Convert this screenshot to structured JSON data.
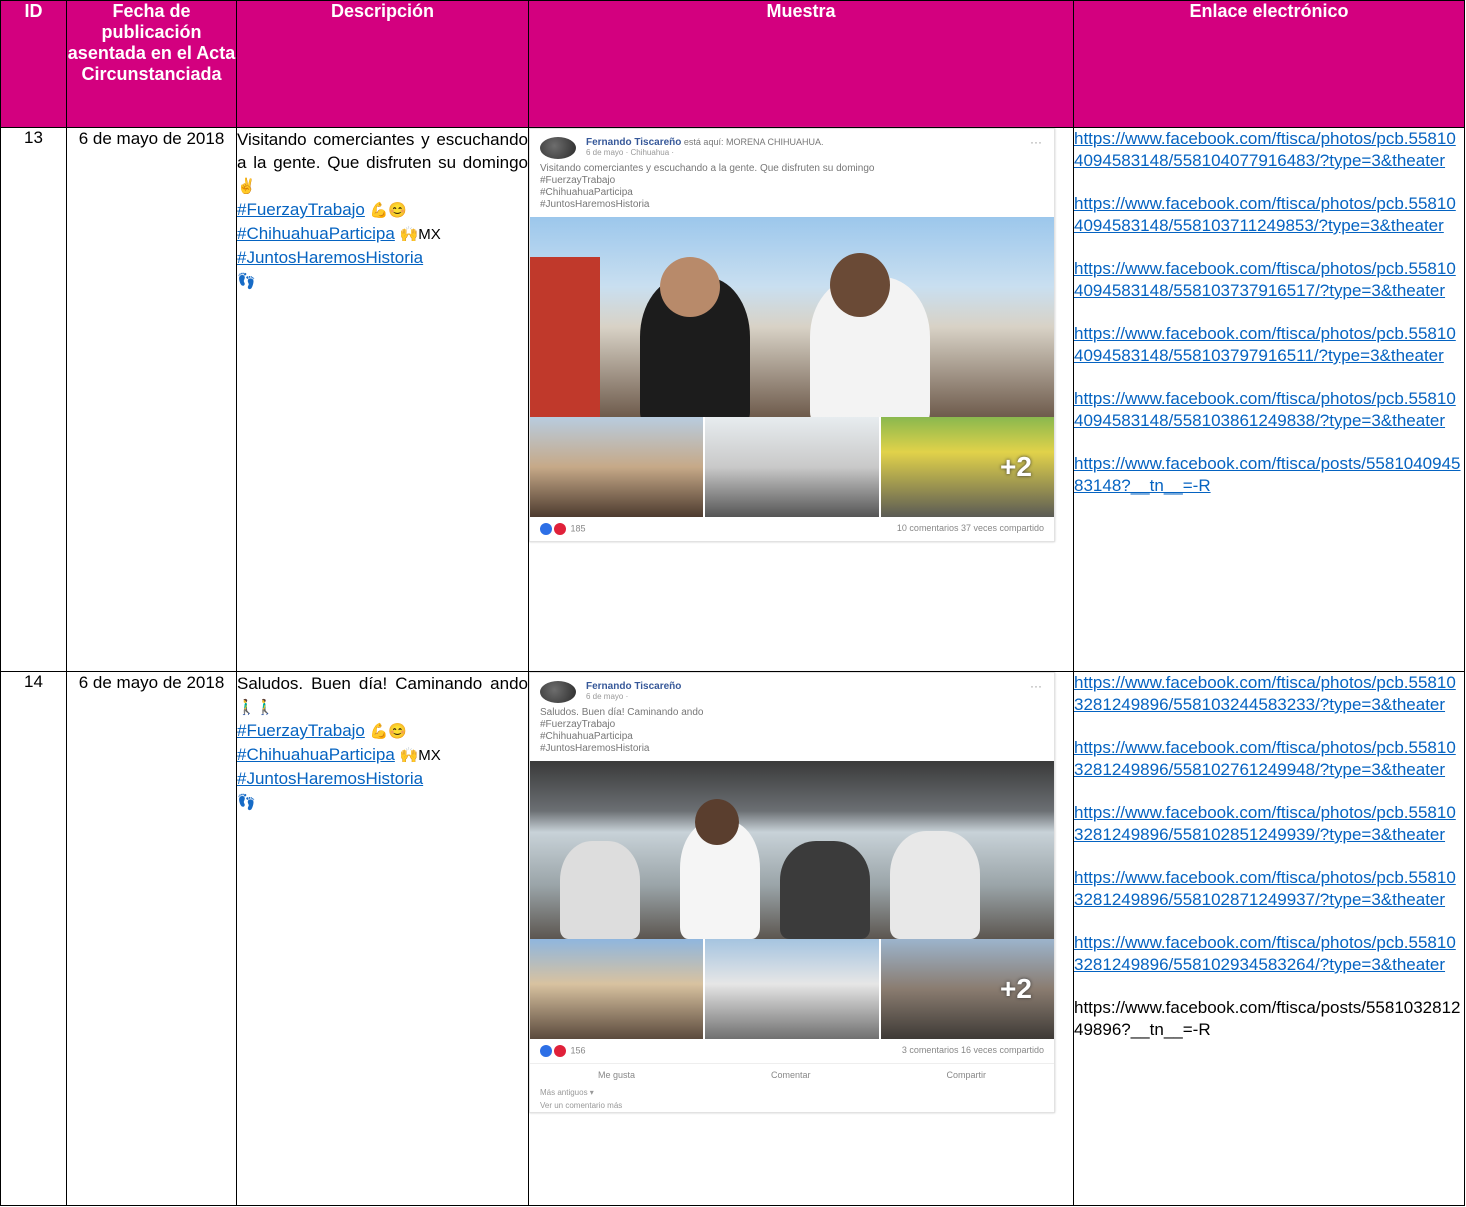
{
  "headers": {
    "id": "ID",
    "fecha": "Fecha de publicación asentada en el Acta Circunstanciada",
    "descripcion": "Descripción",
    "muestra": "Muestra",
    "enlace": "Enlace electrónico"
  },
  "rows": [
    {
      "id": "13",
      "fecha": "6 de mayo de 2018",
      "desc_text": "Visitando comerciantes y escuchando a la gente. Que disfruten su domingo",
      "desc_emoji": "✌",
      "tags": [
        {
          "tag": "#FuerzayTrabajo",
          "emoji": "💪😊"
        },
        {
          "tag": "#ChihuahuaParticipa",
          "emoji": "🙌MX"
        },
        {
          "tag": "#JuntosHaremosHistoria",
          "emoji": ""
        }
      ],
      "tail_emoji": "👣",
      "post": {
        "author": "Fernando Tiscareño",
        "author_suffix": "está aquí: MORENA CHIHUAHUA.",
        "meta": "6 de mayo · Chihuahua ·",
        "text": "Visitando comerciantes y escuchando a la gente. Que disfruten su domingo",
        "tags": [
          "#FuerzayTrabajo",
          "#ChihuahuaParticipa",
          "#JuntosHaremosHistoria"
        ],
        "more": "+2",
        "reactions": "185",
        "stats": "10 comentarios  37 veces compartido"
      },
      "links": [
        "https://www.facebook.com/ftisca/photos/pcb.558104094583148/558104077916483/?type=3&theater",
        "https://www.facebook.com/ftisca/photos/pcb.558104094583148/558103711249853/?type=3&theater",
        "https://www.facebook.com/ftisca/photos/pcb.558104094583148/558103737916517/?type=3&theater",
        "https://www.facebook.com/ftisca/photos/pcb.558104094583148/558103797916511/?type=3&theater",
        "https://www.facebook.com/ftisca/photos/pcb.558104094583148/558103861249838/?type=3&theater",
        "https://www.facebook.com/ftisca/posts/558104094583148?__tn__=-R"
      ]
    },
    {
      "id": "14",
      "fecha": "6 de mayo de 2018",
      "desc_text": "Saludos. Buen día! Caminando ando",
      "desc_emoji": "🚶‍♂🚶‍♂",
      "tags": [
        {
          "tag": "#FuerzayTrabajo",
          "emoji": "💪😊"
        },
        {
          "tag": "#ChihuahuaParticipa",
          "emoji": "🙌MX"
        },
        {
          "tag": "#JuntosHaremosHistoria",
          "emoji": ""
        }
      ],
      "tail_emoji": "👣",
      "post": {
        "author": "Fernando Tiscareño",
        "meta": "6 de mayo ·",
        "text": "Saludos. Buen día! Caminando ando",
        "tags": [
          "#FuerzayTrabajo",
          "#ChihuahuaParticipa",
          "#JuntosHaremosHistoria"
        ],
        "more": "+2",
        "reactions": "156",
        "stats": "3 comentarios  16 veces compartido",
        "actions": [
          "Me gusta",
          "Comentar",
          "Compartir"
        ],
        "sort": "Más antiguos ▾",
        "more_comments": "Ver un comentario más"
      },
      "links": [
        "https://www.facebook.com/ftisca/photos/pcb.558103281249896/558103244583233/?type=3&theater",
        "https://www.facebook.com/ftisca/photos/pcb.558103281249896/558102761249948/?type=3&theater",
        "https://www.facebook.com/ftisca/photos/pcb.558103281249896/558102851249939/?type=3&theater",
        "https://www.facebook.com/ftisca/photos/pcb.558103281249896/558102871249937/?type=3&theater",
        "https://www.facebook.com/ftisca/photos/pcb.558103281249896/558102934583264/?type=3&theater"
      ],
      "plain_link": "https://www.facebook.com/ftisca/posts/558103281249896?__tn__=-R"
    }
  ]
}
